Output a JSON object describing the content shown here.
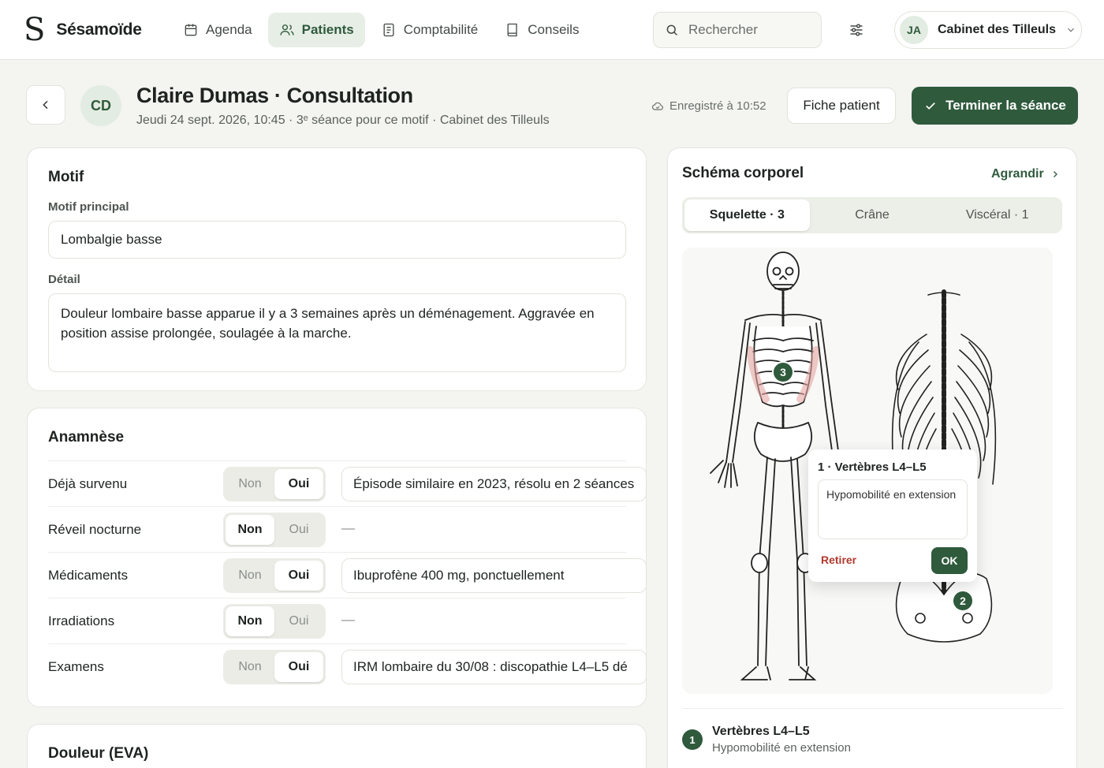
{
  "app": {
    "logo_mark": "S",
    "name": "Sésamoïde"
  },
  "nav": [
    {
      "label": "Agenda",
      "icon": "calendar-icon",
      "active": false
    },
    {
      "label": "Patients",
      "icon": "users-icon",
      "active": true
    },
    {
      "label": "Comptabilité",
      "icon": "receipt-icon",
      "active": false
    },
    {
      "label": "Conseils",
      "icon": "book-icon",
      "active": false
    }
  ],
  "search": {
    "placeholder": "Rechercher"
  },
  "account": {
    "initials": "JA",
    "name": "Cabinet des Tilleuls"
  },
  "header": {
    "initials": "CD",
    "title": "Claire Dumas · Consultation",
    "subtitle": "Jeudi 24 sept. 2026, 10:45 · 3ᵉ séance pour ce motif · Cabinet des Tilleuls",
    "saved": "Enregistré à 10:52",
    "patient_button": "Fiche patient",
    "finish_button": "Terminer la séance"
  },
  "motif": {
    "title": "Motif",
    "main_label": "Motif principal",
    "main_value": "Lombalgie basse",
    "detail_label": "Détail",
    "detail_value": "Douleur lombaire basse apparue il y a 3 semaines après un déménagement. Aggravée en position assise prolongée, soulagée à la marche."
  },
  "anamnese": {
    "title": "Anamnèse",
    "no_label": "Non",
    "yes_label": "Oui",
    "rows": [
      {
        "label": "Déjà survenu",
        "answer": "yes",
        "detail": "Épisode similaire en 2023, résolu en 2 séances"
      },
      {
        "label": "Réveil nocturne",
        "answer": "no",
        "detail": "—"
      },
      {
        "label": "Médicaments",
        "answer": "yes",
        "detail": "Ibuprofène 400 mg, ponctuellement"
      },
      {
        "label": "Irradiations",
        "answer": "no",
        "detail": "—"
      },
      {
        "label": "Examens",
        "answer": "yes",
        "detail": "IRM lombaire du 30/08 : discopathie L4–L5 dé"
      }
    ]
  },
  "pain": {
    "title": "Douleur (EVA)"
  },
  "schema": {
    "title": "Schéma corporel",
    "expand": "Agrandir",
    "tabs": [
      {
        "label": "Squelette · 3",
        "active": true
      },
      {
        "label": "Crâne",
        "active": false
      },
      {
        "label": "Viscéral · 1",
        "active": false
      }
    ],
    "markers": [
      "3",
      "1",
      "2"
    ],
    "popover": {
      "title": "1 · Vertèbres L4–L5",
      "note": "Hypomobilité en extension",
      "remove": "Retirer",
      "ok": "OK"
    },
    "findings": [
      {
        "number": "1",
        "title": "Vertèbres L4–L5",
        "note": "Hypomobilité en extension"
      }
    ]
  },
  "colors": {
    "accent": "#2f5a3c",
    "accent_soft": "#e7eee6",
    "danger": "#b03a2e"
  }
}
